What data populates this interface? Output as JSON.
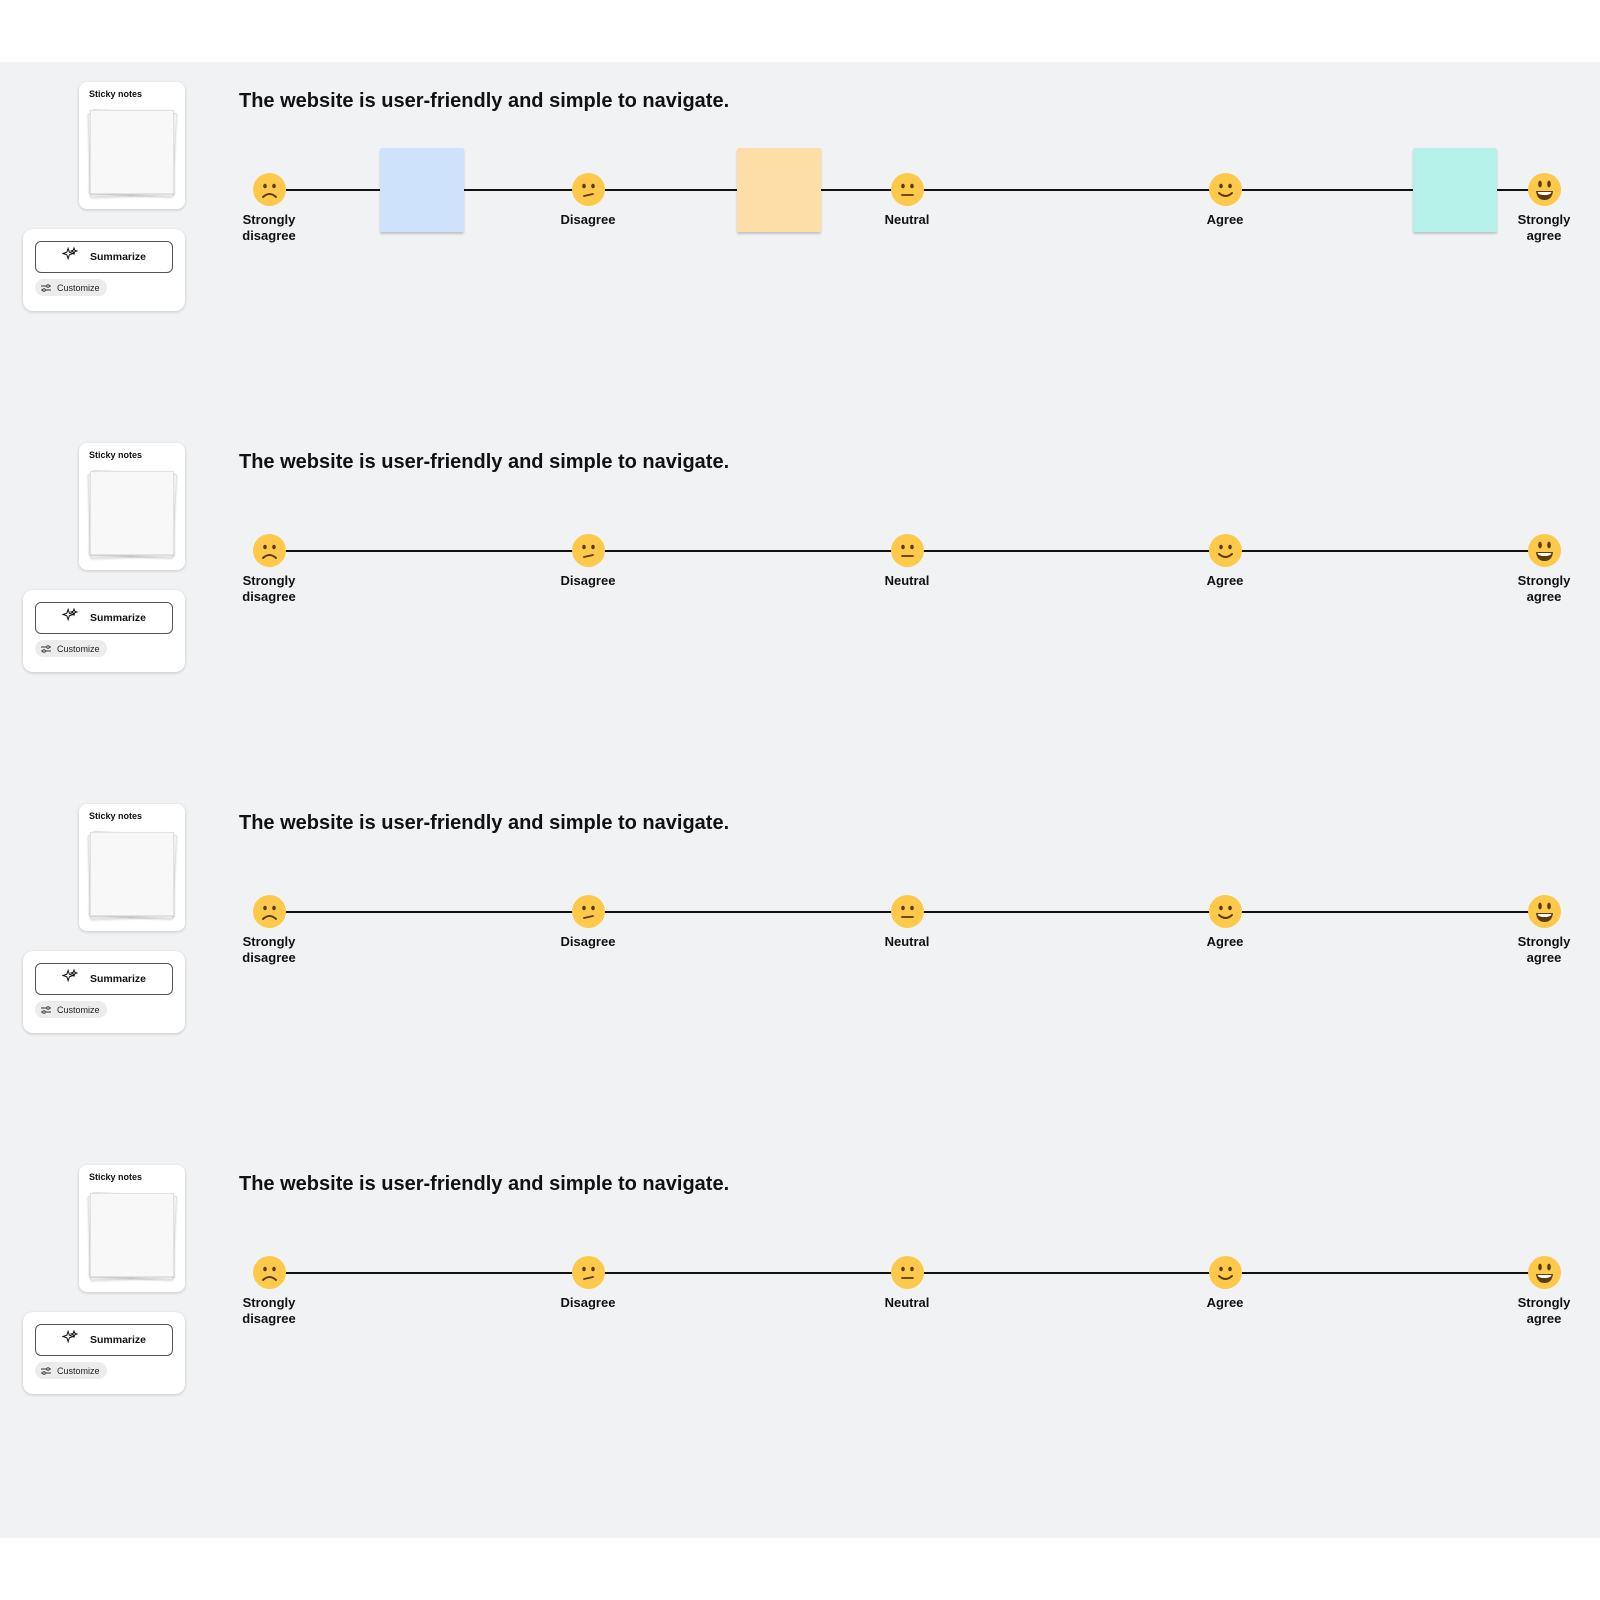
{
  "sidebar": {
    "sticky_notes_label": "Sticky notes",
    "summarize_label": "Summarize",
    "customize_label": "Customize"
  },
  "question": "The website is user-friendly and simple to navigate.",
  "scale_points": [
    {
      "label": "Strongly disagree",
      "icon": "very-sad-face-icon"
    },
    {
      "label": "Disagree",
      "icon": "confused-face-icon"
    },
    {
      "label": "Neutral",
      "icon": "neutral-face-icon"
    },
    {
      "label": "Agree",
      "icon": "smiling-face-icon"
    },
    {
      "label": "Strongly agree",
      "icon": "grinning-face-icon"
    }
  ],
  "sections": [
    {
      "question": "The website is user-friendly and simple to navigate.",
      "sticky_notes": [
        {
          "color": "#cfe2fb",
          "scale_position": 0.12
        },
        {
          "color": "#fddea6",
          "scale_position": 0.4
        },
        {
          "color": "#b5f1e8",
          "scale_position": 0.93
        }
      ]
    },
    {
      "question": "The website is user-friendly and simple to navigate.",
      "sticky_notes": []
    },
    {
      "question": "The website is user-friendly and simple to navigate.",
      "sticky_notes": []
    },
    {
      "question": "The website is user-friendly and simple to navigate.",
      "sticky_notes": []
    }
  ],
  "colors": {
    "canvas": "#f1f2f4",
    "emoji": "#fdc94b",
    "emoji_feature": "#5b3a10",
    "line": "#111111"
  }
}
